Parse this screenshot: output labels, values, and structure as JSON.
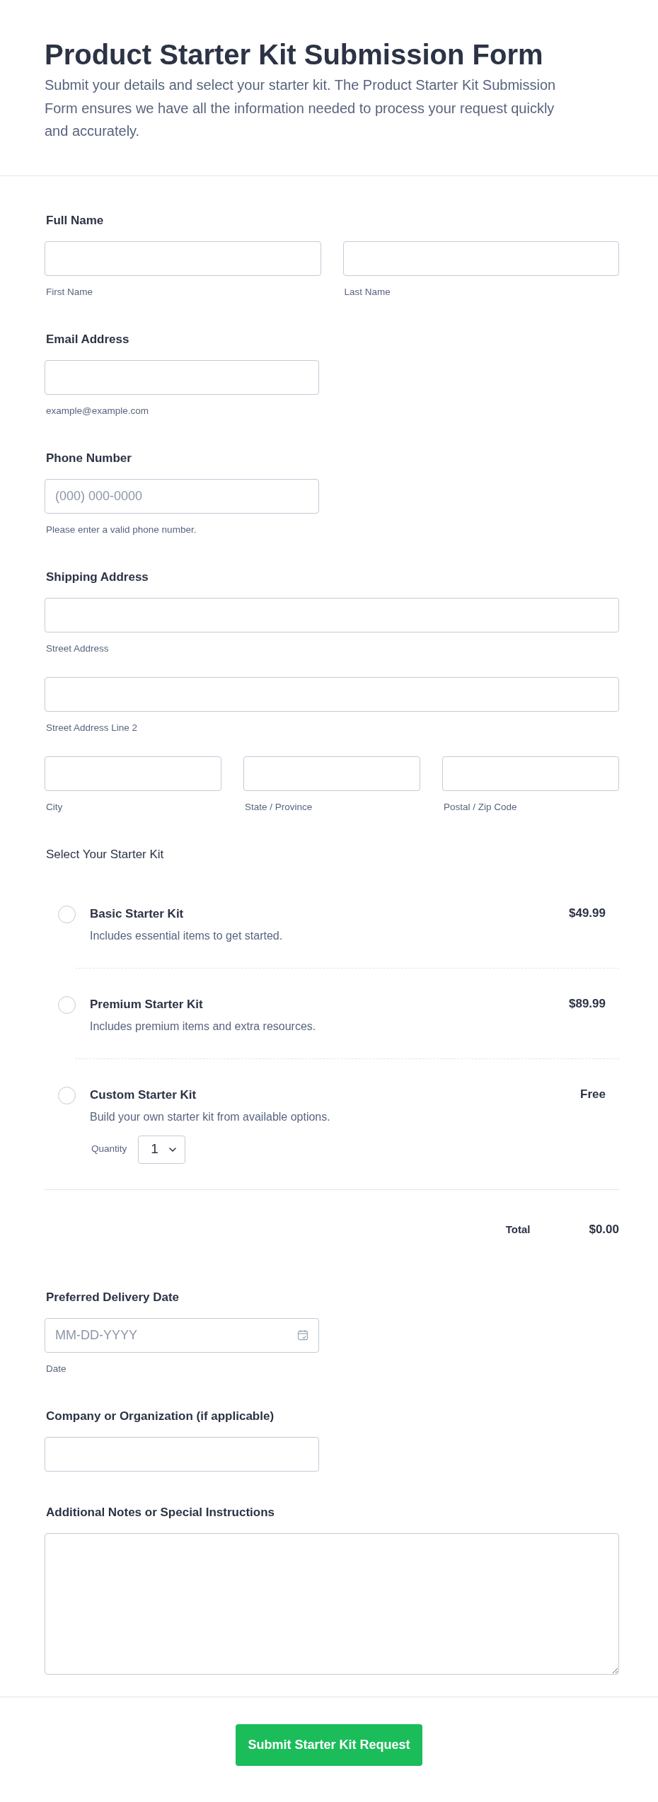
{
  "header": {
    "title": "Product Starter Kit Submission Form",
    "description": "Submit your details and select your starter kit. The Product Starter Kit Submission Form ensures we have all the information needed to process your request quickly and accurately."
  },
  "fields": [
    {
      "kind": "group",
      "label": "Full Name",
      "rows": [
        [
          {
            "caption": "First Name"
          },
          {
            "caption": "Last Name"
          }
        ]
      ]
    },
    {
      "kind": "input",
      "label": "Email Address",
      "caption": "example@example.com"
    },
    {
      "kind": "input",
      "label": "Phone Number",
      "placeholder": "(000) 000-0000",
      "caption": "Please enter a valid phone number."
    },
    {
      "kind": "group",
      "label": "Shipping Address",
      "rows": [
        [
          {
            "caption": "Street Address"
          }
        ],
        [
          {
            "caption": "Street Address Line 2"
          }
        ],
        [
          {
            "caption": "City"
          },
          {
            "caption": "State / Province"
          },
          {
            "caption": "Postal / Zip Code"
          }
        ]
      ]
    },
    {
      "kind": "products",
      "label": "Select Your Starter Kit",
      "products": [
        {
          "name": "Basic Starter Kit",
          "description": "Includes essential items to get started.",
          "price": "$49.99",
          "selected": false
        },
        {
          "name": "Premium Starter Kit",
          "description": "Includes premium items and extra resources.",
          "price": "$89.99",
          "selected": false
        },
        {
          "name": "Custom Starter Kit",
          "description": "Build your own starter kit from available options.",
          "price": "Free",
          "selected": false,
          "quantity": {
            "label": "Quantity",
            "value": "1"
          }
        }
      ],
      "total": {
        "label": "Total",
        "amount": "$0.00"
      }
    },
    {
      "kind": "date",
      "label": "Preferred Delivery Date",
      "placeholder": "MM-DD-YYYY",
      "caption": "Date"
    },
    {
      "kind": "input",
      "label": "Company or Organization (if applicable)"
    },
    {
      "kind": "textarea",
      "label": "Additional Notes or Special Instructions"
    }
  ],
  "submit": {
    "label": "Submit Starter Kit Request"
  }
}
